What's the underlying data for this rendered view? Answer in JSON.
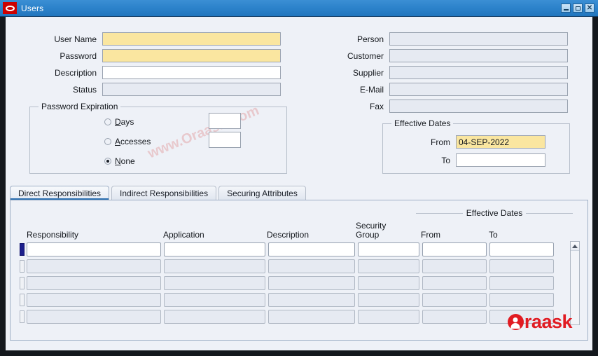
{
  "window": {
    "title": "Users",
    "logo_icon": "oracle-logo-icon",
    "controls": {
      "minimize_label": "Minimize",
      "maximize_label": "Maximize",
      "close_label": "Close"
    }
  },
  "colors": {
    "titlebar": "#2d83cb",
    "canvas": "#eef1f7",
    "required_field": "#fae6a0",
    "disabled_field": "#e6eaf2",
    "accent": "#2d6fb0",
    "brand": "#e11b22",
    "record_indicator": "#1d1f8c"
  },
  "form": {
    "left_fields": [
      {
        "label": "User Name",
        "value": "",
        "state": "required"
      },
      {
        "label": "Password",
        "value": "",
        "state": "required"
      },
      {
        "label": "Description",
        "value": "",
        "state": "editable"
      },
      {
        "label": "Status",
        "value": "",
        "state": "disabled"
      }
    ],
    "right_fields": [
      {
        "label": "Person",
        "value": "",
        "state": "disabled"
      },
      {
        "label": "Customer",
        "value": "",
        "state": "disabled"
      },
      {
        "label": "Supplier",
        "value": "",
        "state": "disabled"
      },
      {
        "label": "E-Mail",
        "value": "",
        "state": "disabled"
      },
      {
        "label": "Fax",
        "value": "",
        "state": "disabled"
      }
    ]
  },
  "password_expiration": {
    "title": "Password Expiration",
    "options": [
      {
        "label": "Days",
        "mnemonic": "D",
        "rest": "ays",
        "selected": false,
        "value": ""
      },
      {
        "label": "Accesses",
        "mnemonic": "A",
        "rest": "ccesses",
        "selected": false,
        "value": ""
      },
      {
        "label": "None",
        "mnemonic": "N",
        "rest": "one",
        "selected": true
      }
    ]
  },
  "effective_dates": {
    "title": "Effective Dates",
    "from_label": "From",
    "from_value": "04-SEP-2022",
    "to_label": "To",
    "to_value": ""
  },
  "tabs": [
    {
      "label": "Direct Responsibilities",
      "active": true
    },
    {
      "label": "Indirect Responsibilities",
      "active": false
    },
    {
      "label": "Securing Attributes",
      "active": false
    }
  ],
  "grid": {
    "effective_dates_group": "Effective Dates",
    "columns": [
      {
        "label": "Responsibility"
      },
      {
        "label": "Application"
      },
      {
        "label": "Description"
      },
      {
        "label": "Security",
        "label2": "Group"
      },
      {
        "label": "From"
      },
      {
        "label": "To"
      }
    ],
    "rows": [
      {
        "current": true,
        "cells": [
          "",
          "",
          "",
          "",
          "",
          ""
        ]
      },
      {
        "current": false,
        "cells": [
          "",
          "",
          "",
          "",
          "",
          ""
        ]
      },
      {
        "current": false,
        "cells": [
          "",
          "",
          "",
          "",
          "",
          ""
        ]
      },
      {
        "current": false,
        "cells": [
          "",
          "",
          "",
          "",
          "",
          ""
        ]
      },
      {
        "current": false,
        "cells": [
          "",
          "",
          "",
          "",
          "",
          ""
        ]
      }
    ],
    "scrollbar": {
      "up_arrow_icon": "chevron-up-icon"
    }
  },
  "watermark": {
    "diagonal_text": "www.Oraask.Com",
    "brand_text": "raask",
    "brand_icon": "person-circle-icon"
  }
}
